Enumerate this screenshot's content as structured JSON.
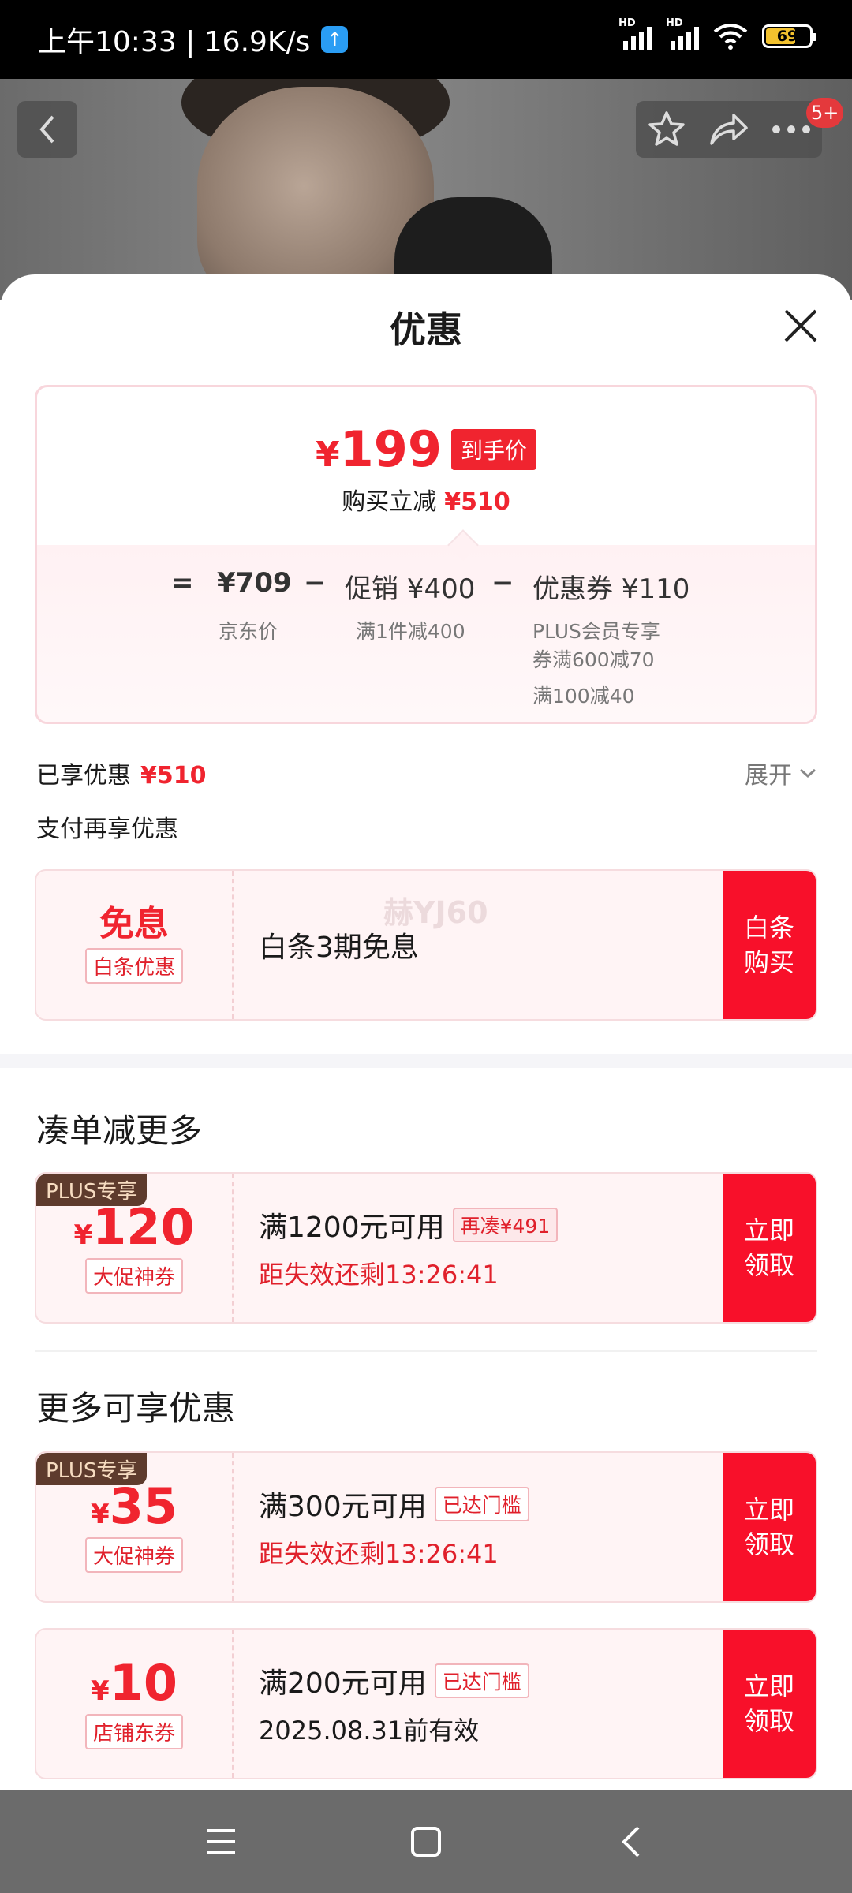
{
  "status_bar": {
    "time": "上午10:33 | 16.9K/s",
    "battery": "69",
    "signal_label": "HD"
  },
  "badge_count": "5+",
  "sheet": {
    "title": "优惠"
  },
  "price_card": {
    "final_price": "199",
    "currency": "¥",
    "price_tag": "到手价",
    "reduce_label": "购买立减",
    "reduce_amount": "¥510",
    "equals": "=",
    "minus": "−",
    "jd_price": "¥709",
    "jd_price_label": "京东价",
    "promo_label": "促销 ¥400",
    "promo_detail": "满1件减400",
    "coupon_label": "优惠券 ¥110",
    "coupon_detail_1": "PLUS会员专享",
    "coupon_detail_2": "券满600减70",
    "coupon_detail_3": "满100减40"
  },
  "enjoyed": {
    "label": "已享优惠",
    "amount": "¥510",
    "expand": "展开"
  },
  "pay": {
    "title": "支付再享优惠",
    "card": {
      "amount": "免息",
      "kind": "白条优惠",
      "line1": "白条3期免息",
      "watermark": "赫YJ60",
      "action_1": "白条",
      "action_2": "购买"
    }
  },
  "section_more": {
    "title": "凑单减更多",
    "coupon": {
      "plus_tag": "PLUS专享",
      "amount": "120",
      "kind": "大促神券",
      "line1": "满1200元可用",
      "chip": "再凑¥491",
      "line2": "距失效还剩13:26:41",
      "action_1": "立即",
      "action_2": "领取"
    }
  },
  "section_extra": {
    "title": "更多可享优惠",
    "coupons": [
      {
        "plus_tag": "PLUS专享",
        "amount": "35",
        "kind": "大促神券",
        "line1": "满300元可用",
        "chip": "已达门槛",
        "line2": "距失效还剩13:26:41",
        "action_1": "立即",
        "action_2": "领取"
      },
      {
        "amount": "10",
        "kind": "店铺东券",
        "line1": "满200元可用",
        "chip": "已达门槛",
        "line2": "2025.08.31前有效",
        "action_1": "立即",
        "action_2": "领取"
      }
    ]
  },
  "colors": {
    "accent": "#f0242f",
    "action_red": "#f8102a",
    "plus_brown": "#5e3b2d"
  },
  "icons": [
    "upload-icon",
    "wifi-icon",
    "back-arrow-icon",
    "star-icon",
    "share-icon",
    "more-icon",
    "close-icon",
    "chevron-down-icon",
    "menu-icon",
    "home-icon",
    "nav-back-icon"
  ]
}
